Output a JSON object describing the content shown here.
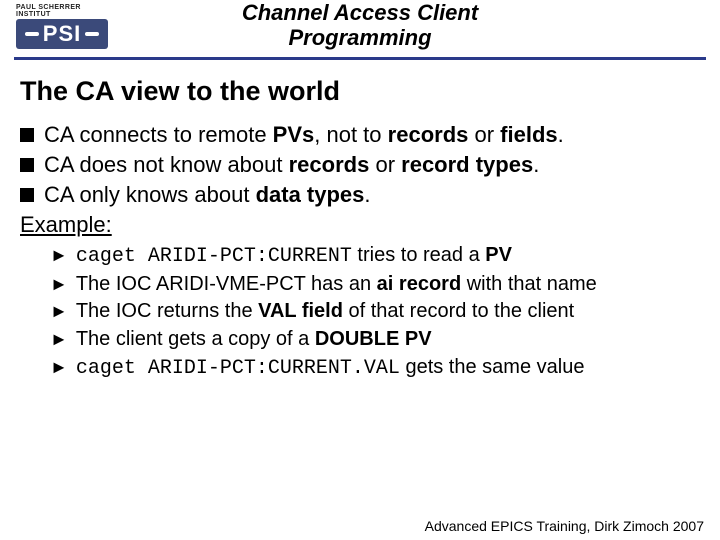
{
  "logo": {
    "top_text": "PAUL SCHERRER INSTITUT",
    "text": "PSI"
  },
  "header": {
    "line1": "Channel Access Client",
    "line2": "Programming"
  },
  "section_title": "The CA view to the world",
  "bullets": {
    "b0": {
      "p0": "CA connects to remote ",
      "p1": "PVs",
      "p2": ", not to ",
      "p3": "records",
      "p4": " or ",
      "p5": "fields",
      "p6": "."
    },
    "b1": {
      "p0": "CA does not know about ",
      "p1": "records",
      "p2": " or ",
      "p3": "record types",
      "p4": "."
    },
    "b2": {
      "p0": "CA only knows about ",
      "p1": "data types",
      "p2": "."
    }
  },
  "example_label": "Example:",
  "sub": {
    "s0": {
      "p0": "caget ARIDI-PCT:CURRENT",
      "p1": " tries to read a ",
      "p2": "PV"
    },
    "s1": {
      "p0": "The IOC ARIDI-VME-PCT has an ",
      "p1": "ai record",
      "p2": " with that name"
    },
    "s2": {
      "p0": "The IOC returns the ",
      "p1": "VAL field",
      "p2": " of that record to the client"
    },
    "s3": {
      "p0": "The client gets a copy of a ",
      "p1": "DOUBLE PV"
    },
    "s4": {
      "p0": "caget ARIDI-PCT:CURRENT.VAL",
      "p1": " gets the same value"
    }
  },
  "footer": "Advanced EPICS Training, Dirk Zimoch 2007"
}
